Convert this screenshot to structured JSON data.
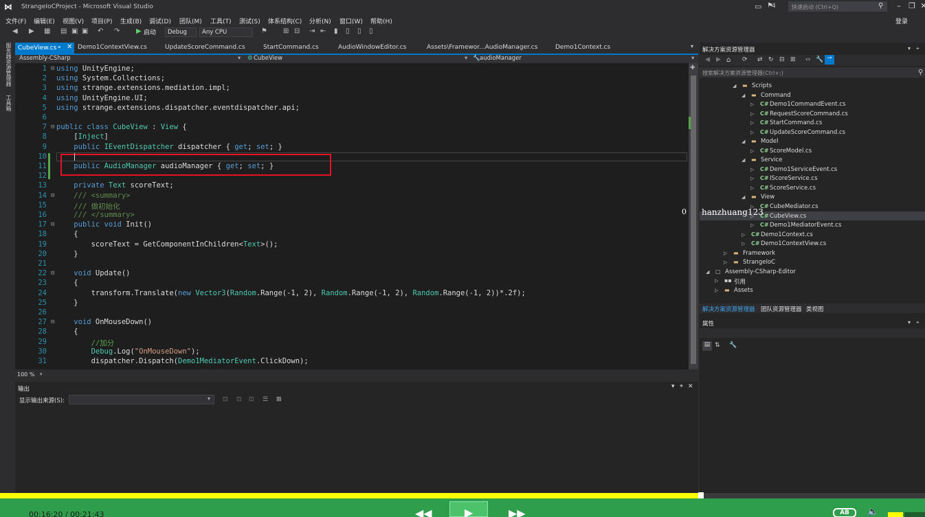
{
  "window": {
    "title": "StrangeIoCProject - Microsoft Visual Studio",
    "flag_count": "4",
    "quick_launch_placeholder": "快速启动 (Ctrl+Q)",
    "login": "登录",
    "controls": [
      "minimize-icon",
      "restore-icon",
      "close-icon"
    ]
  },
  "menu": [
    "文件(F)",
    "编辑(E)",
    "视图(V)",
    "项目(P)",
    "生成(B)",
    "调试(D)",
    "团队(M)",
    "工具(T)",
    "测试(S)",
    "体系结构(C)",
    "分析(N)",
    "窗口(W)",
    "帮助(H)"
  ],
  "toolbar": {
    "start_label": "启动",
    "config": "Debug",
    "platform": "Any CPU"
  },
  "left_strip": {
    "server_explorer": "服务器资源管理器",
    "toolbox": "工具箱"
  },
  "tabs": {
    "active": "CubeView.cs",
    "others": [
      "Demo1ContextView.cs",
      "UpdateScoreCommand.cs",
      "StartCommand.cs",
      "AudioWindowEditor.cs",
      "Assets\\Framewor...AudioManager.cs",
      "Demo1Context.cs"
    ]
  },
  "navbar": {
    "project": "Assembly-CSharp",
    "type": "CubeView",
    "member": "audioManager"
  },
  "code": {
    "lines": [
      "1",
      "2",
      "3",
      "4",
      "5",
      "6",
      "7",
      "8",
      "9",
      "10",
      "11",
      "12",
      "13",
      "14",
      "15",
      "16",
      "17",
      "18",
      "19",
      "20",
      "21",
      "22",
      "23",
      "24",
      "25",
      "26",
      "27",
      "28",
      "29",
      "30",
      "31"
    ]
  },
  "zoom": "100 %",
  "output": {
    "title": "输出",
    "source_label": "显示输出来源(S):"
  },
  "solution_explorer": {
    "title": "解决方案资源管理器",
    "search_placeholder": "搜索解决方案资源管理器(Ctrl+;)",
    "tree": [
      {
        "label": "Scripts",
        "kind": "folder"
      },
      {
        "label": "Command",
        "kind": "folder"
      },
      {
        "label": "Demo1CommandEvent.cs",
        "kind": "cs"
      },
      {
        "label": "RequestScoreCommand.cs",
        "kind": "cs"
      },
      {
        "label": "StartCommand.cs",
        "kind": "cs"
      },
      {
        "label": "UpdateScoreCommand.cs",
        "kind": "cs"
      },
      {
        "label": "Model",
        "kind": "folder"
      },
      {
        "label": "ScoreModel.cs",
        "kind": "cs"
      },
      {
        "label": "Service",
        "kind": "folder"
      },
      {
        "label": "Demo1ServiceEvent.cs",
        "kind": "cs"
      },
      {
        "label": "IScoreService.cs",
        "kind": "cs"
      },
      {
        "label": "ScoreService.cs",
        "kind": "cs"
      },
      {
        "label": "View",
        "kind": "folder"
      },
      {
        "label": "CubeMediator.cs",
        "kind": "cs"
      },
      {
        "label": "CubeView.cs",
        "kind": "cs"
      },
      {
        "label": "Demo1MediatorEvent.cs",
        "kind": "cs"
      },
      {
        "label": "Demo1Context.cs",
        "kind": "cs"
      },
      {
        "label": "Demo1ContextView.cs",
        "kind": "cs"
      },
      {
        "label": "Framework",
        "kind": "folder"
      },
      {
        "label": "StrangeIoC",
        "kind": "folder"
      },
      {
        "label": "Assembly-CSharp-Editor",
        "kind": "project"
      },
      {
        "label": "引用",
        "kind": "ref"
      },
      {
        "label": "Assets",
        "kind": "folder"
      }
    ],
    "bottom_tabs": [
      "解决方案资源管理器",
      "团队资源管理器",
      "类视图"
    ]
  },
  "watermark": "hanzhuang123",
  "watermark_zero": "0",
  "properties": {
    "title": "属性"
  },
  "player": {
    "time": "00:16:20 / 00:21:43",
    "progress": 0.755,
    "ab_label": "AB",
    "volume": 0.4
  }
}
